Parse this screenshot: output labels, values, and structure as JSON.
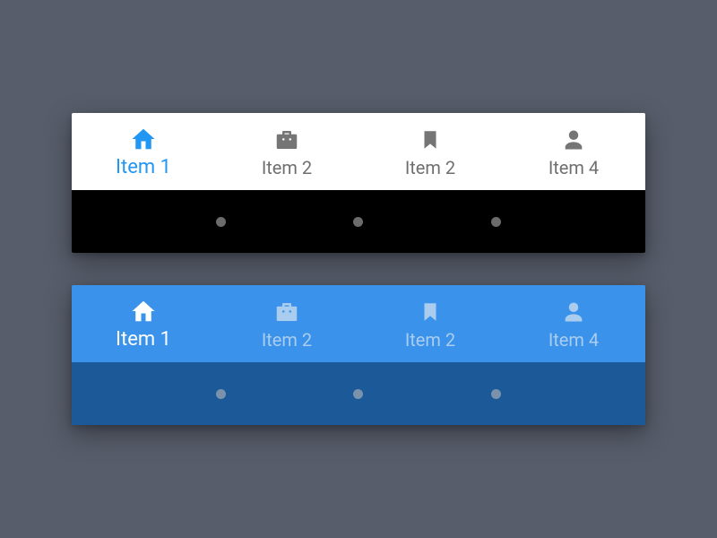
{
  "variants": {
    "light": {
      "tabs": [
        {
          "label": "Item 1",
          "icon": "home",
          "active": true
        },
        {
          "label": "Item 2",
          "icon": "briefcase",
          "active": false
        },
        {
          "label": "Item 2",
          "icon": "bookmark",
          "active": false
        },
        {
          "label": "Item 4",
          "icon": "user",
          "active": false
        }
      ]
    },
    "blue": {
      "tabs": [
        {
          "label": "Item 1",
          "icon": "home",
          "active": true
        },
        {
          "label": "Item 2",
          "icon": "briefcase",
          "active": false
        },
        {
          "label": "Item 2",
          "icon": "bookmark",
          "active": false
        },
        {
          "label": "Item 4",
          "icon": "user",
          "active": false
        }
      ]
    }
  },
  "colors": {
    "accent": "#2196f3",
    "light_bg": "#ffffff",
    "light_inactive": "#757575",
    "light_dot_bg": "#000000",
    "blue_bar": "#3a92ea",
    "blue_dot_bg": "#1b5999",
    "blue_inactive": "#aacdef",
    "blue_active": "#ffffff"
  }
}
